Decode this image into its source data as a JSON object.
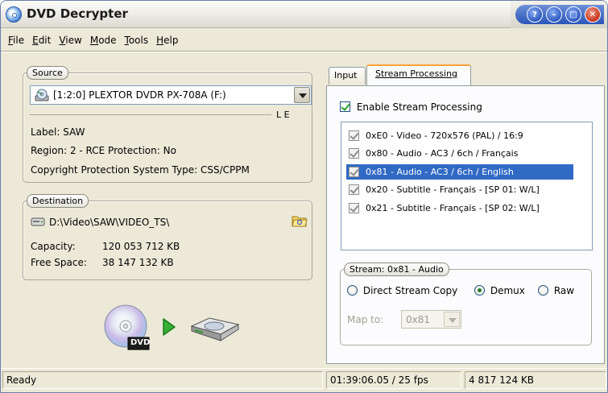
{
  "window": {
    "title": "DVD Decrypter"
  },
  "title_buttons": [
    "help",
    "minimize-round",
    "maximize",
    "close"
  ],
  "menu": {
    "items": [
      {
        "accel": "F",
        "rest": "ile"
      },
      {
        "accel": "E",
        "rest": "dit"
      },
      {
        "accel": "V",
        "rest": "iew"
      },
      {
        "accel": "M",
        "rest": "ode"
      },
      {
        "accel": "T",
        "rest": "ools"
      },
      {
        "accel": "H",
        "rest": "elp"
      }
    ]
  },
  "source": {
    "legend": "Source",
    "drive": "[1:2:0] PLEXTOR DVDR   PX-708A (F:)",
    "flags": "L  E",
    "label": "Label:   SAW",
    "region": "Region:  2  - RCE Protection:  No",
    "copyright": "Copyright Protection System Type:  CSS/CPPM"
  },
  "destination": {
    "legend": "Destination",
    "path": "D:\\Video\\SAW\\VIDEO_TS\\",
    "capacity_label": "Capacity:",
    "capacity_value": "120 053 712 KB",
    "free_label": "Free Space:",
    "free_value": "38 147 132 KB"
  },
  "actions": {
    "dvd_badge": "DVD"
  },
  "tabs": {
    "input": "Input",
    "stream_processing": "Stream Processing"
  },
  "stream_panel": {
    "enable_label": "Enable Stream Processing",
    "enable_checked": true,
    "streams": [
      {
        "label": "0xE0 - Video - 720x576 (PAL) / 16:9",
        "checked": true,
        "selected": false
      },
      {
        "label": "0x80 - Audio - AC3 / 6ch / Français",
        "checked": true,
        "selected": false
      },
      {
        "label": "0x81 - Audio - AC3 / 6ch / English",
        "checked": true,
        "selected": true
      },
      {
        "label": "0x20 - Subtitle - Français - [SP 01: W/L]",
        "checked": true,
        "selected": false
      },
      {
        "label": "0x21 - Subtitle - Français - [SP 02: W/L]",
        "checked": true,
        "selected": false
      }
    ],
    "stream_group_legend": "Stream: 0x81 - Audio",
    "radio_direct": "Direct Stream Copy",
    "radio_demux": "Demux",
    "radio_raw": "Raw",
    "selected_mode": "Demux",
    "map_to_label": "Map to:",
    "map_to_value": "0x81"
  },
  "statusbar": {
    "status": "Ready",
    "time": "01:39:06.05 / 25 fps",
    "size": "4 817 124 KB"
  },
  "colors": {
    "selection": "#316ac5",
    "window_bg": "#ece9d8",
    "tab_highlight": "#f7a23d"
  }
}
